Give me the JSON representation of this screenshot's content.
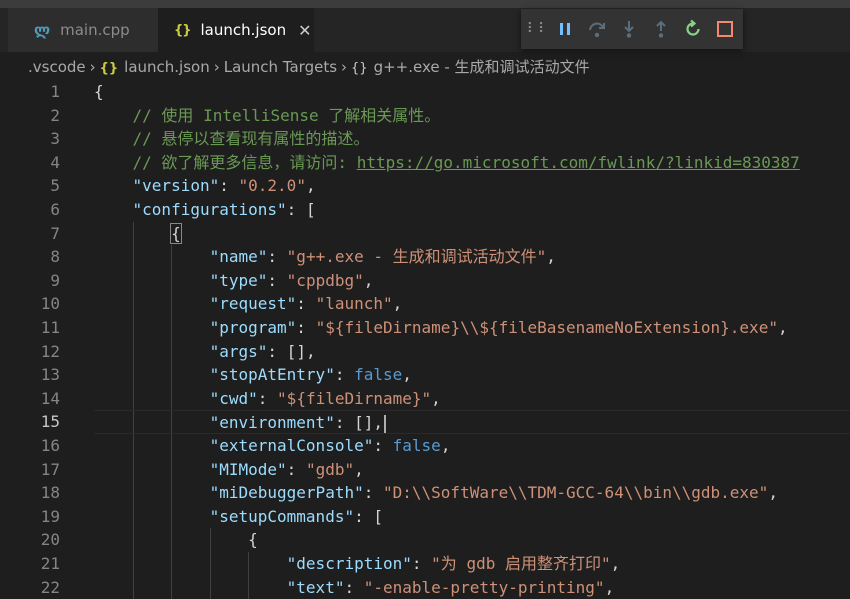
{
  "tabs": [
    {
      "label": "main.cpp",
      "icon": "cpp-file-icon",
      "active": false
    },
    {
      "label": "launch.json",
      "icon": "json-file-icon",
      "active": true,
      "close": "✕"
    }
  ],
  "breadcrumb": {
    "folder": ".vscode",
    "file": "launch.json",
    "section": "Launch Targets",
    "item": "g++.exe - 生成和调试活动文件"
  },
  "debug_toolbar": [
    "drag-grip-icon",
    "pause-icon",
    "step-over-icon",
    "step-into-icon",
    "step-out-icon",
    "restart-icon",
    "stop-icon"
  ],
  "colors": {
    "background": "#1e1e1e",
    "comment": "#6a9955",
    "key": "#9cdcfe",
    "string": "#ce9178",
    "keyword": "#569cd6",
    "restart": "#89d185",
    "stop": "#f48771",
    "pause": "#75beff"
  },
  "editor": {
    "current_line": 15,
    "lines": [
      {
        "n": "1",
        "text": "{"
      },
      {
        "n": "2",
        "text": "    // 使用 IntelliSense 了解相关属性。"
      },
      {
        "n": "3",
        "text": "    // 悬停以查看现有属性的描述。"
      },
      {
        "n": "4",
        "text": "    // 欲了解更多信息，请访问: https://go.microsoft.com/fwlink/?linkid=830387"
      },
      {
        "n": "5",
        "text": "    \"version\": \"0.2.0\","
      },
      {
        "n": "6",
        "text": "    \"configurations\": ["
      },
      {
        "n": "7",
        "text": "        {"
      },
      {
        "n": "8",
        "text": "            \"name\": \"g++.exe - 生成和调试活动文件\","
      },
      {
        "n": "9",
        "text": "            \"type\": \"cppdbg\","
      },
      {
        "n": "10",
        "text": "            \"request\": \"launch\","
      },
      {
        "n": "11",
        "text": "            \"program\": \"${fileDirname}\\\\${fileBasenameNoExtension}.exe\","
      },
      {
        "n": "12",
        "text": "            \"args\": [],"
      },
      {
        "n": "13",
        "text": "            \"stopAtEntry\": false,"
      },
      {
        "n": "14",
        "text": "            \"cwd\": \"${fileDirname}\","
      },
      {
        "n": "15",
        "text": "            \"environment\": [],"
      },
      {
        "n": "16",
        "text": "            \"externalConsole\": false,"
      },
      {
        "n": "17",
        "text": "            \"MIMode\": \"gdb\","
      },
      {
        "n": "18",
        "text": "            \"miDebuggerPath\": \"D:\\\\SoftWare\\\\TDM-GCC-64\\\\bin\\\\gdb.exe\","
      },
      {
        "n": "19",
        "text": "            \"setupCommands\": ["
      },
      {
        "n": "20",
        "text": "                {"
      },
      {
        "n": "21",
        "text": "                    \"description\": \"为 gdb 启用整齐打印\","
      },
      {
        "n": "22",
        "text": "                    \"text\": \"-enable-pretty-printing\","
      }
    ]
  }
}
